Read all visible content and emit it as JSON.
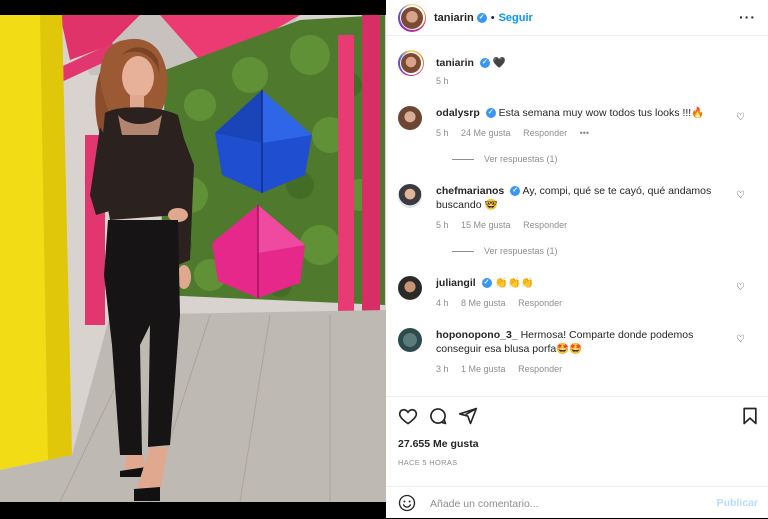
{
  "post": {
    "author": "taniarin",
    "follow_label": "Seguir",
    "caption_emoji": "🖤",
    "caption_time": "5 h",
    "likes": "27.655 Me gusta",
    "time_ago": "HACE 5 HORAS"
  },
  "comments": [
    {
      "user": "odalysrp",
      "text": "Esta semana muy wow todos tus looks !!!🔥",
      "time": "5 h",
      "likes": "24 Me gusta",
      "reply_label": "Responder",
      "view_replies": "Ver respuestas (1)"
    },
    {
      "user": "chefmarianos",
      "text": "Ay, compi, qué se te cayó, qué andamos buscando 🤓",
      "time": "5 h",
      "likes": "15 Me gusta",
      "reply_label": "Responder",
      "view_replies": "Ver respuestas (1)"
    },
    {
      "user": "juliangil",
      "text": "👏👏👏",
      "time": "4 h",
      "likes": "8 Me gusta",
      "reply_label": "Responder"
    },
    {
      "user": "hoponopono_3_",
      "text": "Hermosa! Comparte donde podemos conseguir esa blusa porfa🤩🤩",
      "time": "3 h",
      "likes": "1 Me gusta",
      "reply_label": "Responder"
    }
  ],
  "composer": {
    "placeholder": "Añade un comentario...",
    "publish_label": "Publicar"
  },
  "colors": {
    "accent": "#0095f6",
    "verified": "#3897f0",
    "muted": "#8e8e8e"
  },
  "icons": [
    "verified-icon",
    "more-icon",
    "heart-icon",
    "comment-icon",
    "share-icon",
    "save-icon",
    "emoji-icon"
  ]
}
